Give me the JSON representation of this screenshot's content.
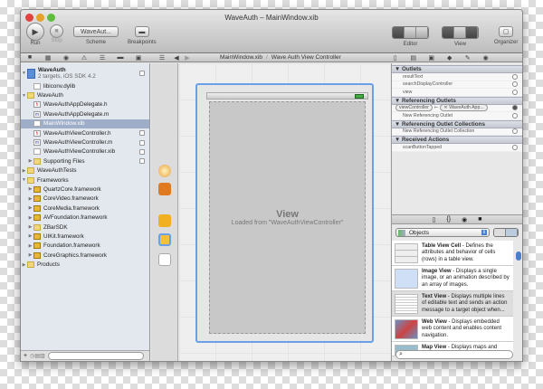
{
  "window": {
    "title": "WaveAuth – MainWindow.xib"
  },
  "toolbar": {
    "run": "Run",
    "stop": "Stop",
    "scheme_label": "Scheme",
    "scheme_value": "WaveAut...",
    "breakpoints": "Breakpoints",
    "editor": "Editor",
    "view": "View",
    "organizer": "Organizer"
  },
  "jumpbar": {
    "file": "MainWindow.xib",
    "object": "Wave Auth View Controller"
  },
  "navigator": {
    "project": "WaveAuth",
    "project_sub": "2 targets, iOS SDK 4.2",
    "items": [
      "libiconv.dylib",
      "WaveAuth",
      "WaveAuthAppDelegate.h",
      "WaveAuthAppDelegate.m",
      "MainWindow.xib",
      "WaveAuthViewController.h",
      "WaveAuthViewController.m",
      "WaveAuthViewController.xib",
      "Supporting Files",
      "WaveAuthTests",
      "Frameworks",
      "QuartzCore.framework",
      "CoreVideo.framework",
      "CoreMedia.framework",
      "AVFoundation.framework",
      "ZBarSDK",
      "UIKit.framework",
      "Foundation.framework",
      "CoreGraphics.framework",
      "Products"
    ]
  },
  "canvas": {
    "view_title": "View",
    "view_sub": "Loaded from \"WaveAuthViewController\""
  },
  "connections": {
    "outlets_header": "Outlets",
    "outlets": [
      "resultText",
      "searchDisplayController",
      "view"
    ],
    "ref_header": "Referencing Outlets",
    "ref_from": "viewController",
    "ref_to": "WaveAuth App...",
    "ref_new": "New Referencing Outlet",
    "coll_header": "Referencing Outlet Collections",
    "coll_new": "New Referencing Outlet Collection",
    "actions_header": "Received Actions",
    "actions": [
      "scanButtonTapped"
    ]
  },
  "library": {
    "selector": "Objects",
    "items": [
      {
        "name": "Table View Cell",
        "desc": " - Defines the attributes and behavior of cells (rows) in a table view."
      },
      {
        "name": "Image View",
        "desc": " - Displays a single image, or an animation described by an array of images."
      },
      {
        "name": "Text View",
        "desc": " - Displays multiple lines of editable text and sends an action message to a target object when..."
      },
      {
        "name": "Web View",
        "desc": " - Displays embedded web content and enables content navigation."
      },
      {
        "name": "Map View",
        "desc": " - Displays maps and"
      }
    ]
  },
  "colors": {
    "selection": "#9eaec9",
    "frame": "#6aa0e8"
  }
}
